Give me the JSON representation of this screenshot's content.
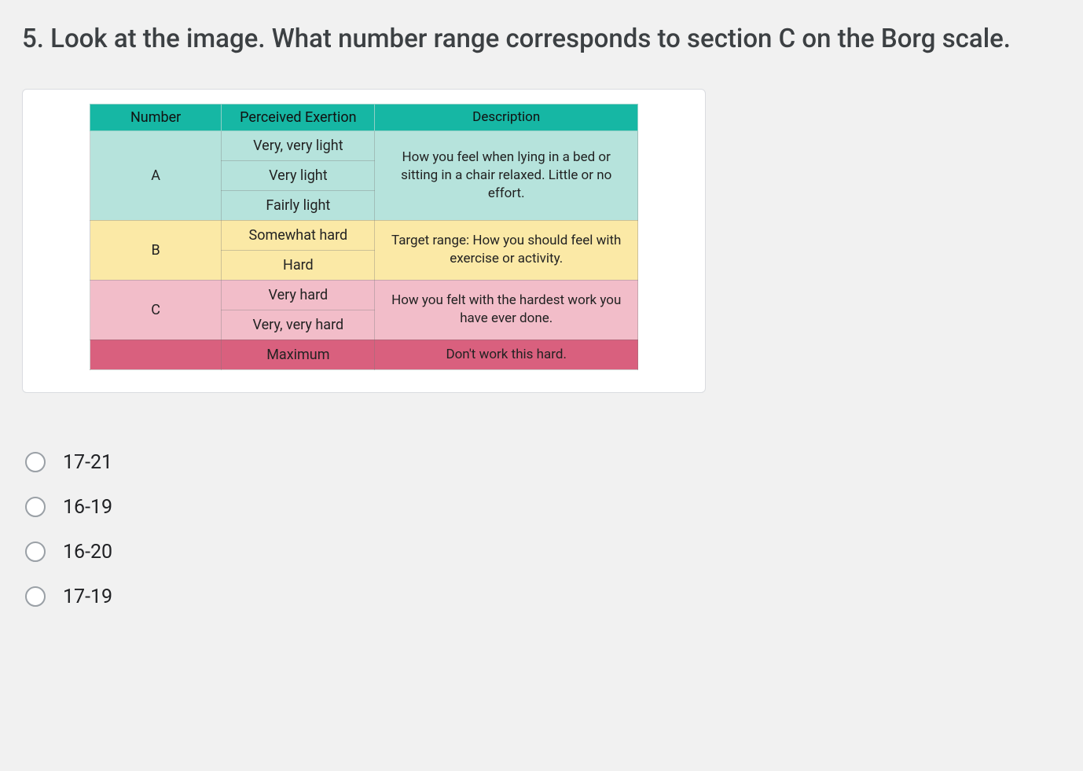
{
  "question": {
    "number": "5.",
    "text": "Look at the image. What number range corresponds to section C on the Borg scale."
  },
  "table": {
    "headers": {
      "number": "Number",
      "exertion": "Perceived  Exertion",
      "description": "Description"
    },
    "sectionA": {
      "label": "A",
      "exertions": [
        "Very, very light",
        "Very light",
        "Fairly light"
      ],
      "description": "How you feel when lying in a bed or sitting in a chair relaxed. Little or no effort."
    },
    "sectionB": {
      "label": "B",
      "exertions": [
        "Somewhat hard",
        "Hard"
      ],
      "description": "Target range: How you should feel with exercise or activity."
    },
    "sectionC": {
      "label": "C",
      "exertions": [
        "Very hard",
        "Very, very hard"
      ],
      "description": "How you felt with the hardest work you have ever done."
    },
    "max": {
      "exertion": "Maximum",
      "description": "Don't work this hard."
    }
  },
  "options": [
    "17-21",
    "16-19",
    "16-20",
    "17-19"
  ]
}
